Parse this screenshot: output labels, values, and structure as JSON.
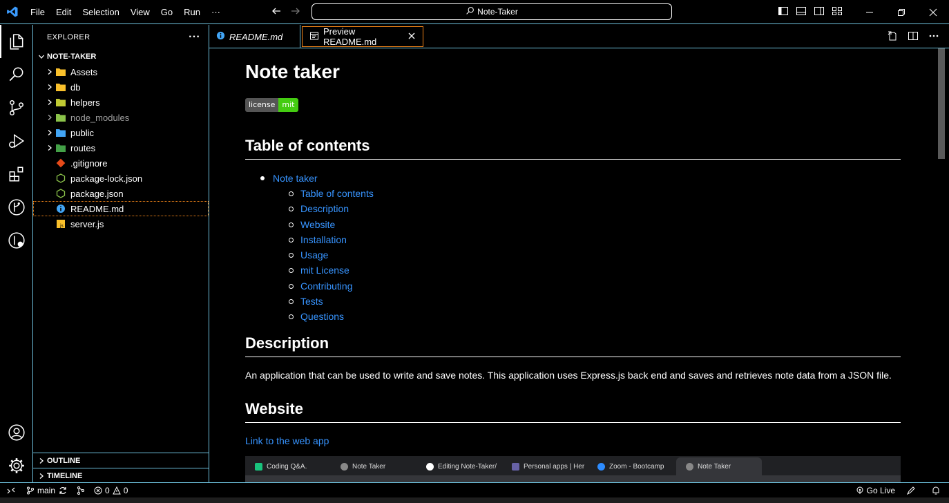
{
  "titlebar": {
    "menu": [
      "File",
      "Edit",
      "Selection",
      "View",
      "Go",
      "Run",
      "···"
    ],
    "search_text": "Note-Taker"
  },
  "sidebar": {
    "header": "EXPLORER",
    "more": "···",
    "project": "NOTE-TAKER",
    "items": [
      {
        "label": "Assets",
        "type": "folder",
        "color": "#f9c02b"
      },
      {
        "label": "db",
        "type": "folder",
        "color": "#f9c02b"
      },
      {
        "label": "helpers",
        "type": "folder",
        "color": "#c0ca33"
      },
      {
        "label": "node_modules",
        "type": "folder",
        "color": "#8bc34a"
      },
      {
        "label": "public",
        "type": "folder",
        "color": "#42a5f5"
      },
      {
        "label": "routes",
        "type": "folder",
        "color": "#43a047"
      },
      {
        "label": ".gitignore",
        "type": "file",
        "icon": "git-icon"
      },
      {
        "label": "package-lock.json",
        "type": "file",
        "icon": "nodejs-icon"
      },
      {
        "label": "package.json",
        "type": "file",
        "icon": "nodejs-icon"
      },
      {
        "label": "README.md",
        "type": "file",
        "icon": "info-icon"
      },
      {
        "label": "server.js",
        "type": "file",
        "icon": "js-icon"
      }
    ],
    "outline": "OUTLINE",
    "timeline": "TIMELINE"
  },
  "tabs": [
    {
      "label": "README.md"
    },
    {
      "label": "Preview README.md"
    }
  ],
  "readme": {
    "title": "Note taker",
    "badge_left": "license",
    "badge_right": "mit",
    "toc_heading": "Table of contents",
    "toc_top": "Note taker",
    "toc_items": [
      "Table of contents",
      "Description",
      "Website",
      "Installation",
      "Usage",
      "mit License",
      "Contributing",
      "Tests",
      "Questions"
    ],
    "description_heading": "Description",
    "description_text": "An application that can be used to write and save notes. This application uses Express.js back end and saves and retrieves note data from a JSON file.",
    "website_heading": "Website",
    "website_link": "Link to the web app"
  },
  "browser_tabs": [
    "Coding Q&A.",
    "Note Taker",
    "Editing Note-Taker/",
    "Personal apps | Her",
    "Zoom - Bootcamp",
    "Note Taker"
  ],
  "statusbar": {
    "branch": "main",
    "errors": "0",
    "warnings": "0",
    "go_live": "Go Live"
  },
  "colors": {
    "accent_border": "#6fc3df",
    "focus_border": "#f38518",
    "link": "#3794ff"
  }
}
